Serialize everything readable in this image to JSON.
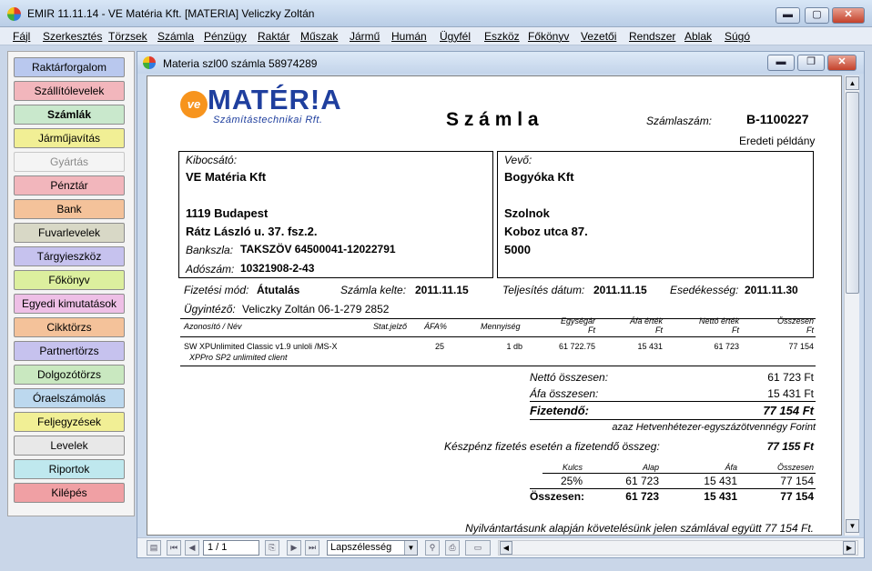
{
  "window": {
    "title": "EMIR 11.11.14 - VE Matéria Kft. [MATERIA] Veliczky Zoltán",
    "minimize_label": "▬",
    "maximize_label": "▢",
    "close_label": "✕"
  },
  "menu": [
    "Fájl",
    "Szerkesztés",
    "Törzsek",
    "Számla",
    "Pénzügy",
    "Raktár",
    "Műszak",
    "Jármű",
    "Humán",
    "Ügyfél",
    "Eszköz",
    "Főkönyv",
    "Vezetői",
    "Rendszer",
    "Ablak",
    "Súgó"
  ],
  "sidebar": [
    {
      "label": "Raktárforgalom",
      "color": "#b9c8ee"
    },
    {
      "label": "Szállítólevelek",
      "color": "#f2b6bc"
    },
    {
      "label": "Számlák",
      "color": "#c9e8cc",
      "active": true
    },
    {
      "label": "Járműjavítás",
      "color": "#f1ef95"
    },
    {
      "label": "Gyártás",
      "color": "#f4f4f4",
      "disabled": true
    },
    {
      "label": "Pénztár",
      "color": "#f2b6bc"
    },
    {
      "label": "Bank",
      "color": "#f4c29a"
    },
    {
      "label": "Fuvarlevelek",
      "color": "#d8d8c6"
    },
    {
      "label": "Tárgyieszköz",
      "color": "#c6c2ee"
    },
    {
      "label": "Főkönyv",
      "color": "#dcef9e"
    },
    {
      "label": "Egyedi kimutatások",
      "color": "#eebfe6"
    },
    {
      "label": "Cikktörzs",
      "color": "#f4c29a"
    },
    {
      "label": "Partnertörzs",
      "color": "#c6c2ee"
    },
    {
      "label": "Dolgozótörzs",
      "color": "#c9e8c0"
    },
    {
      "label": "Óraelszámolás",
      "color": "#bcd8ee"
    },
    {
      "label": "Feljegyzések",
      "color": "#f1ef95"
    },
    {
      "label": "Levelek",
      "color": "#e8e8e8"
    },
    {
      "label": "Riportok",
      "color": "#bfe8ee"
    },
    {
      "label": "Kilépés",
      "color": "#f0a0a4"
    }
  ],
  "doc": {
    "title": "Materia szl00 számla 58974289",
    "minimize_label": "▬",
    "maximize_label": "❐",
    "close_label": "✕"
  },
  "invoice": {
    "logo_mark": "ve",
    "logo_text": "MATÉR!A",
    "logo_sub": "Számítástechnikai Rft.",
    "heading": "S z á m l a",
    "number_label": "Számlaszám:",
    "number": "B-1100227",
    "copy_note": "Eredeti példány",
    "issuer_label": "Kibocsátó:",
    "issuer_name": "VE Matéria Kft",
    "issuer_city": "1119 Budapest",
    "issuer_street": "Rátz László u. 37. fsz.2.",
    "bank_label": "Bankszla:",
    "bank_value": "TAKSZÖV 64500041-12022791",
    "tax_label": "Adószám:",
    "tax_value": "10321908-2-43",
    "buyer_label": "Vevő:",
    "buyer_name": "Bogyóka Kft",
    "buyer_city": "Szolnok",
    "buyer_street": "Koboz utca 87.",
    "buyer_zip": "5000",
    "payment_label": "Fizetési mód:",
    "payment_value": "Átutalás",
    "date_label": "Számla kelte:",
    "date_value": "2011.11.15",
    "perf_label": "Teljesítés dátum:",
    "perf_value": "2011.11.15",
    "due_label": "Esedékesség:",
    "due_value": "2011.11.30",
    "agent_label": "Ügyintéző:",
    "agent_value": "Veliczky Zoltán 06-1-279 2852",
    "columns": {
      "name": "Azonosító / Név",
      "stat": "Stat.jelző",
      "vat": "ÁFA%",
      "qty": "Mennyiség",
      "unit_price": "Egységár",
      "unit_price_unit": "Ft",
      "vat_value": "Áfa érték",
      "vat_value_unit": "Ft",
      "net_value": "Nettó érték",
      "net_value_unit": "Ft",
      "total": "Összesen",
      "total_unit": "Ft"
    },
    "item": {
      "name_line1": "SW XPUnlimited Classic v1.9 unloli /MS-X",
      "name_line2": "XPPro SP2 unlimited client",
      "vat": "25",
      "qty": "1 db",
      "unit_price": "61 722.75",
      "vat_value": "15 431",
      "net_value": "61 723",
      "total": "77 154"
    },
    "net_total_label": "Nettó összesen:",
    "net_total": "61 723 Ft",
    "vat_total_label": "Áfa összesen:",
    "vat_total": "15 431 Ft",
    "payable_label": "Fizetendő:",
    "payable": "77 154 Ft",
    "payable_words": "azaz Hetvenhétezer-egyszázötvennégy Forint",
    "cash_label": "Készpénz fizetés esetén a fizetendő összeg:",
    "cash_value": "77 155 Ft",
    "summary_headers": {
      "rate": "Kulcs",
      "base": "Alap",
      "vat": "Áfa",
      "total": "Összesen"
    },
    "summary_row": {
      "rate": "25%",
      "base": "61 723",
      "vat": "15 431",
      "total": "77 154"
    },
    "summary_total": {
      "label": "Összesen:",
      "base": "61 723",
      "vat": "15 431",
      "total": "77 154"
    },
    "footer_note": "Nyilvántartásunk alapján követelésünk jelen számlával együtt 77 154 Ft."
  },
  "toolbar": {
    "page": "1 / 1",
    "zoom": "Lapszélesség"
  }
}
